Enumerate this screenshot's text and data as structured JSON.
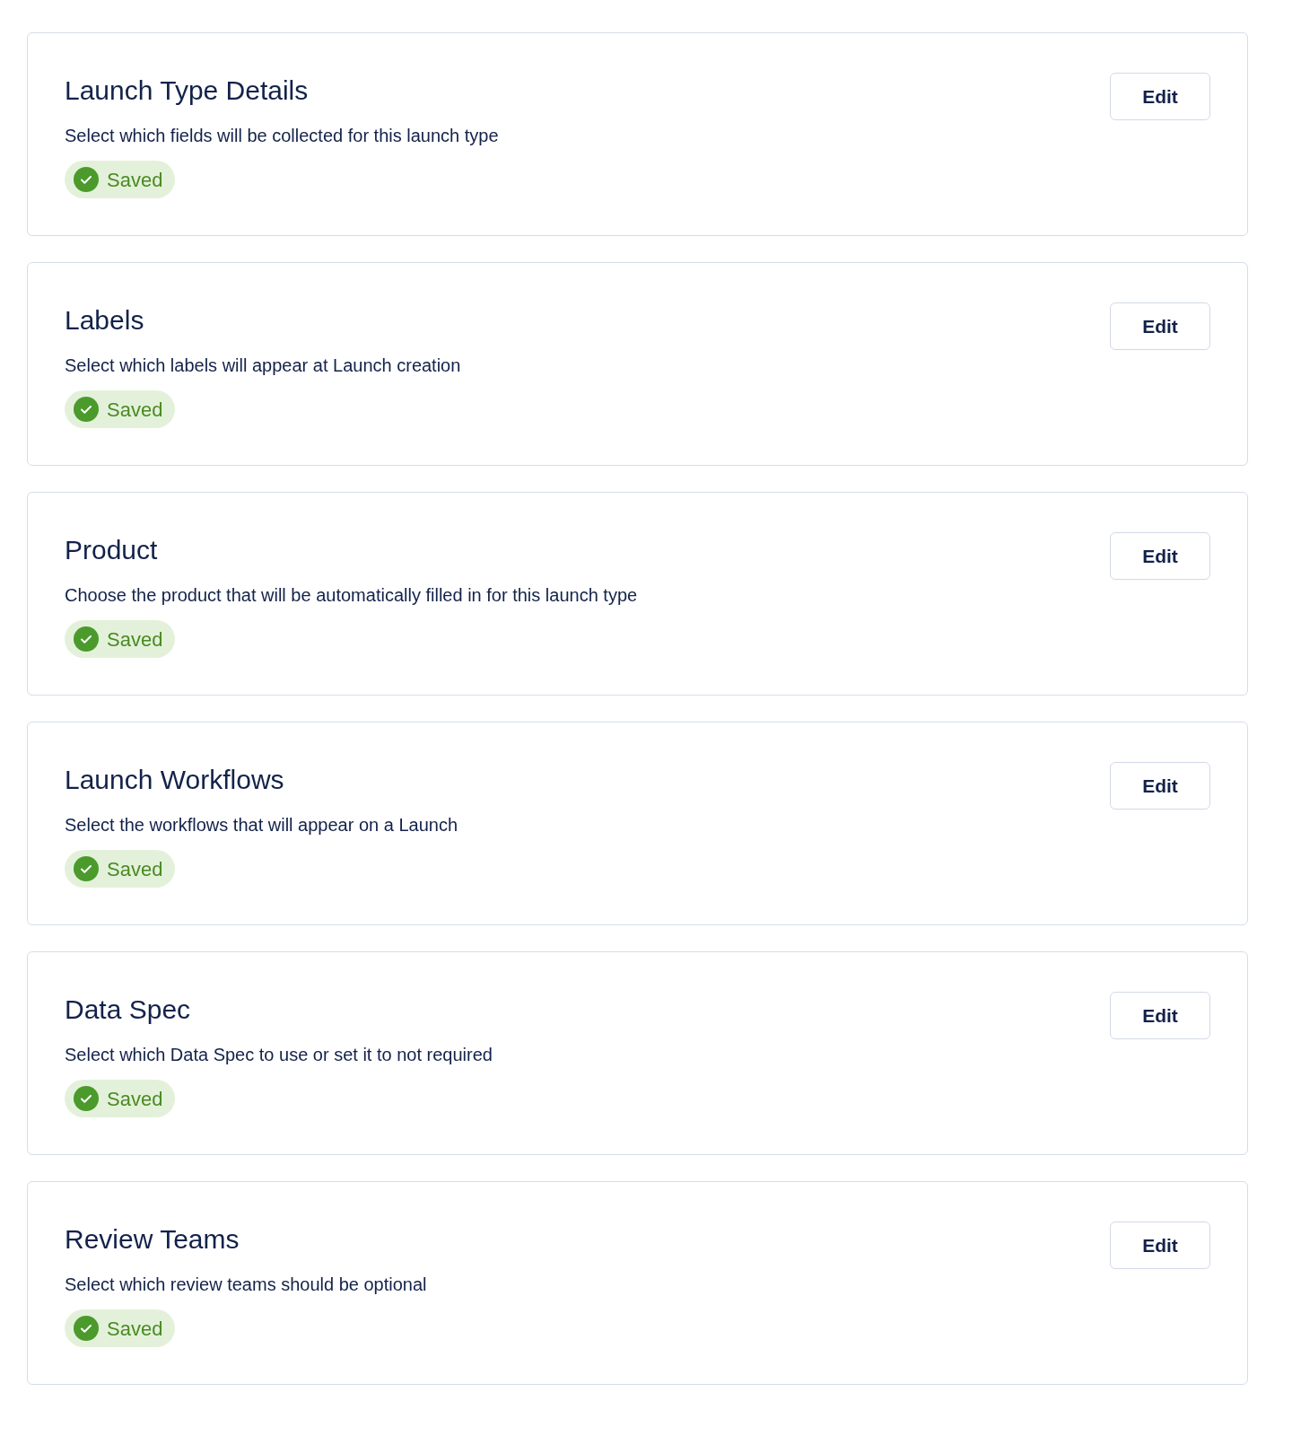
{
  "sections": [
    {
      "title": "Launch Type Details",
      "description": "Select which fields will be collected for this launch type",
      "status": {
        "kind": "saved",
        "label": "Saved"
      },
      "button": "Edit"
    },
    {
      "title": "Labels",
      "description": "Select which labels will appear at Launch creation",
      "status": {
        "kind": "saved",
        "label": "Saved"
      },
      "button": "Edit"
    },
    {
      "title": "Product",
      "description": "Choose the product that will be automatically filled in for this launch type",
      "status": {
        "kind": "saved",
        "label": "Saved"
      },
      "button": "Edit"
    },
    {
      "title": "Launch Workflows",
      "description": "Select the workflows that will appear on a Launch",
      "status": {
        "kind": "saved",
        "label": "Saved"
      },
      "button": "Edit"
    },
    {
      "title": "Data Spec",
      "description": "Select which Data Spec to use or set it to not required",
      "status": {
        "kind": "saved",
        "label": "Saved"
      },
      "button": "Edit"
    },
    {
      "title": "Review Teams",
      "description": "Select which review teams should be optional",
      "status": {
        "kind": "saved",
        "label": "Saved"
      },
      "button": "Edit"
    }
  ]
}
